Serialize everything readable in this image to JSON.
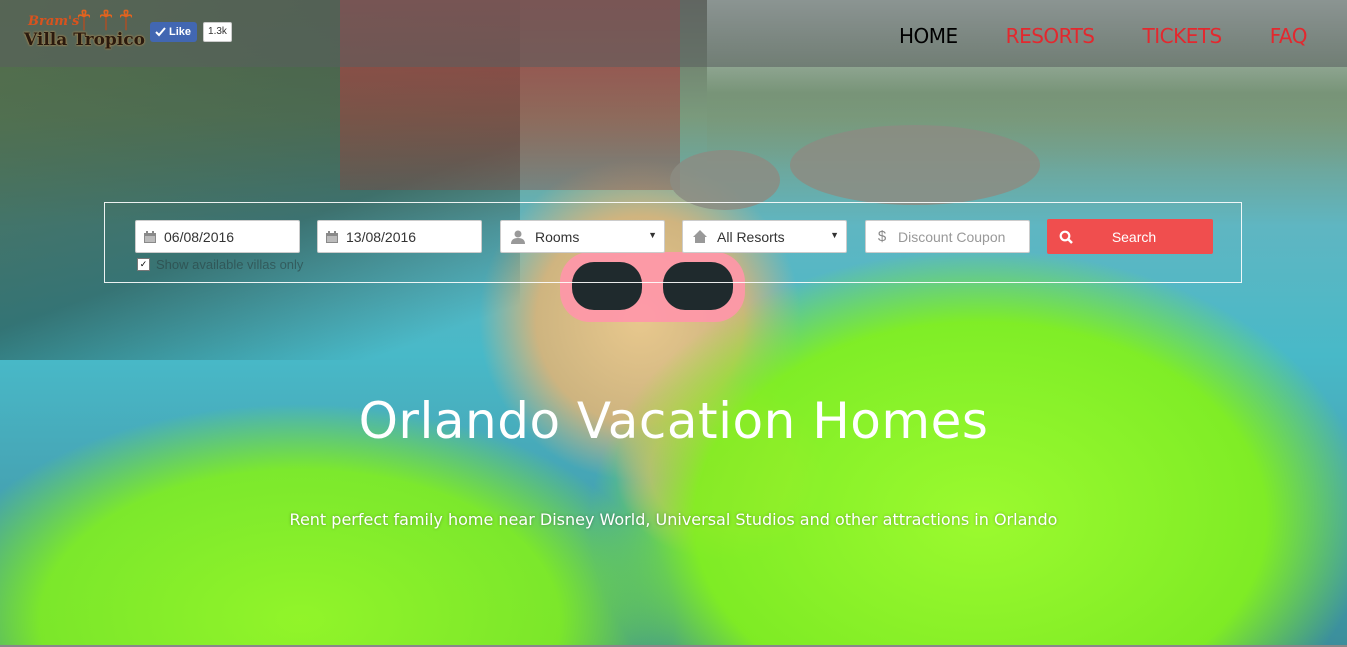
{
  "header": {
    "logo": {
      "script": "Bram's",
      "name": "Villa Tropico"
    },
    "fb": {
      "like_label": "Like",
      "count": "1.3k"
    },
    "nav": [
      {
        "label": "HOME"
      },
      {
        "label": "RESORTS"
      },
      {
        "label": "TICKETS"
      },
      {
        "label": "FAQ"
      }
    ]
  },
  "search": {
    "checkin": "06/08/2016",
    "checkout": "13/08/2016",
    "rooms": "Rooms",
    "resort": "All Resorts",
    "coupon_placeholder": "Discount Coupon",
    "button_label": "Search",
    "available_label": "Show available villas only",
    "available_checked": true
  },
  "hero": {
    "title": "Orlando Vacation Homes",
    "subtitle": "Rent perfect family home near Disney World, Universal Studios and other attractions in Orlando"
  },
  "colors": {
    "accent": "#f04e4e",
    "nav_active": "#000000",
    "nav_link": "#e3282e",
    "fb_blue": "#4267b2"
  }
}
